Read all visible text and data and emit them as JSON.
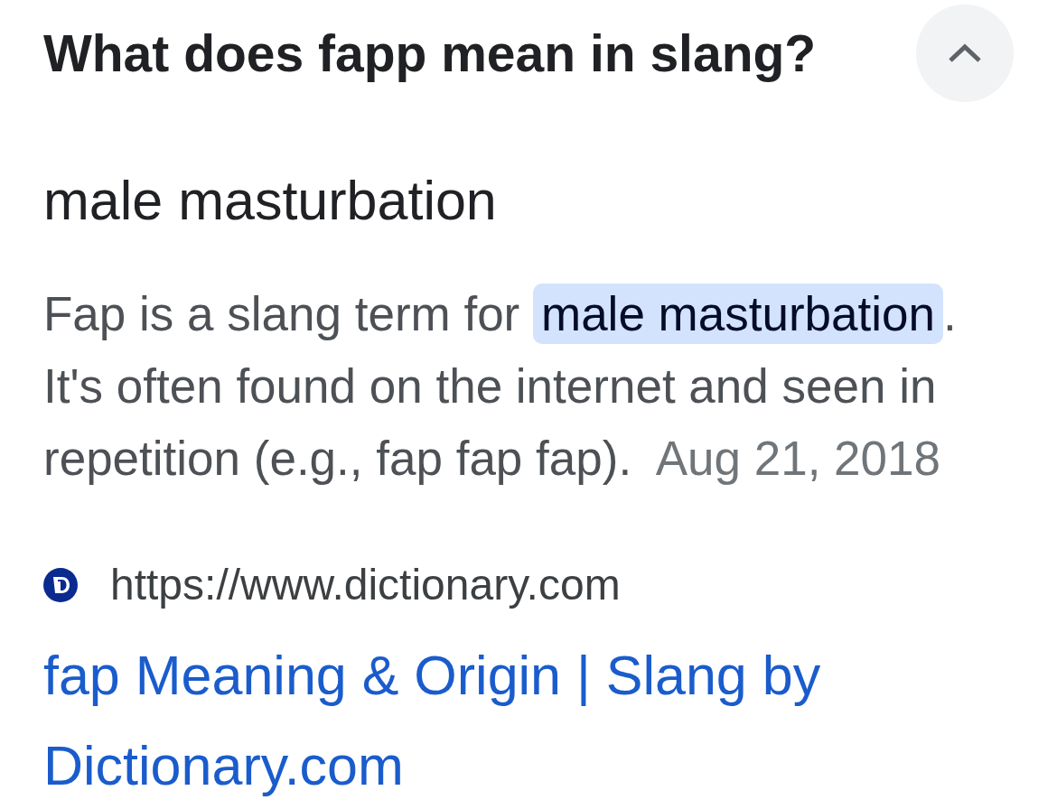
{
  "question": {
    "title": "What does fapp mean in slang?",
    "expanded": true
  },
  "answer": {
    "heading": "male masturbation",
    "text_before": "Fap is a slang term for ",
    "highlight": "male masturbation",
    "text_after": ". It's often found on the internet and seen in repetition (e.g., fap fap fap).",
    "date": "Aug 21, 2018"
  },
  "source": {
    "url": "https://www.dictionary.com",
    "title": "fap Meaning & Origin | Slang by Dictionary.com"
  }
}
